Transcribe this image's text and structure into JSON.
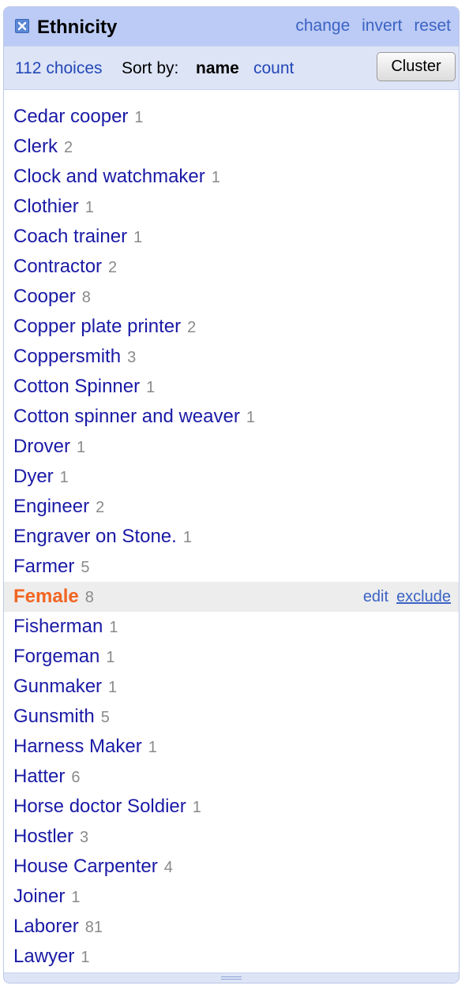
{
  "facet": {
    "title": "Ethnicity",
    "actions": {
      "change": "change",
      "invert": "invert",
      "reset": "reset"
    },
    "close_icon": "close-x-icon"
  },
  "controls": {
    "choices_count": "112 choices",
    "sort_label": "Sort by:",
    "sort_name": "name",
    "sort_count": "count",
    "cluster_label": "Cluster"
  },
  "choices": [
    {
      "label": "Cedar cooper",
      "count": "1"
    },
    {
      "label": "Clerk",
      "count": "2"
    },
    {
      "label": "Clock and watchmaker",
      "count": "1"
    },
    {
      "label": "Clothier",
      "count": "1"
    },
    {
      "label": "Coach trainer",
      "count": "1"
    },
    {
      "label": "Contractor",
      "count": "2"
    },
    {
      "label": "Cooper",
      "count": "8"
    },
    {
      "label": "Copper plate printer",
      "count": "2"
    },
    {
      "label": "Coppersmith",
      "count": "3"
    },
    {
      "label": "Cotton Spinner",
      "count": "1"
    },
    {
      "label": "Cotton spinner and weaver",
      "count": "1"
    },
    {
      "label": "Drover",
      "count": "1"
    },
    {
      "label": "Dyer",
      "count": "1"
    },
    {
      "label": "Engineer",
      "count": "2"
    },
    {
      "label": "Engraver on Stone.",
      "count": "1"
    },
    {
      "label": "Farmer",
      "count": "5"
    },
    {
      "label": "Female",
      "count": "8",
      "selected": true,
      "edit": "edit",
      "exclude": "exclude"
    },
    {
      "label": "Fisherman",
      "count": "1"
    },
    {
      "label": "Forgeman",
      "count": "1"
    },
    {
      "label": "Gunmaker",
      "count": "1"
    },
    {
      "label": "Gunsmith",
      "count": "5"
    },
    {
      "label": "Harness Maker",
      "count": "1"
    },
    {
      "label": "Hatter",
      "count": "6"
    },
    {
      "label": "Horse doctor Soldier",
      "count": "1"
    },
    {
      "label": "Hostler",
      "count": "3"
    },
    {
      "label": "House Carpenter",
      "count": "4"
    },
    {
      "label": "Joiner",
      "count": "1"
    },
    {
      "label": "Laborer",
      "count": "81"
    },
    {
      "label": "Lawyer",
      "count": "1"
    }
  ],
  "colors": {
    "title_bar": "#bccbf5",
    "controls_bar": "#dde4f6",
    "choice_link": "#1a1aa6",
    "selected_choice": "#f26522",
    "count_gray": "#8a8a8a",
    "action_link": "#3b63c5"
  }
}
